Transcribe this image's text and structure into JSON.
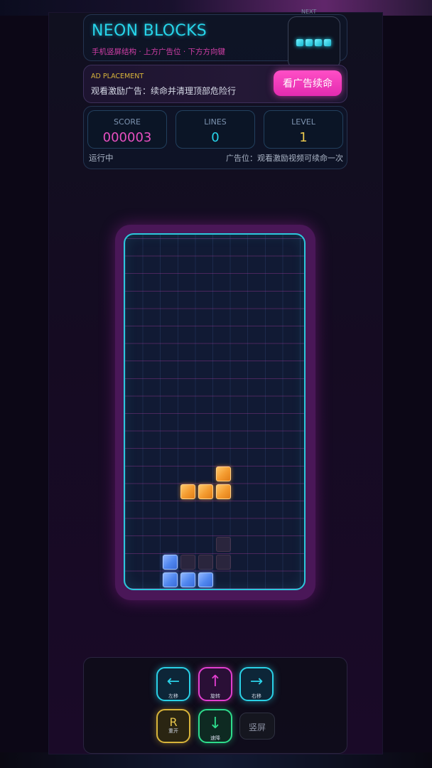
{
  "header": {
    "title": "NEON BLOCKS",
    "subtitle": "手机竖屏结构 · 上方广告位 · 下方方向键",
    "next_label": "NEXT"
  },
  "ad": {
    "label": "AD PLACEMENT",
    "text": "观看激励广告：续命并清理顶部危险行",
    "button": "看广告续命"
  },
  "stats": {
    "score_label": "SCORE",
    "score_value": "000003",
    "lines_label": "LINES",
    "lines_value": "0",
    "level_label": "LEVEL",
    "level_value": "1"
  },
  "status": {
    "state": "运行中",
    "hint": "广告位：观看激励视频可续命一次"
  },
  "board": {
    "cols": 10,
    "rows": 20,
    "cells": [
      {
        "col": 5,
        "row": 13,
        "color": "orange"
      },
      {
        "col": 3,
        "row": 14,
        "color": "orange"
      },
      {
        "col": 4,
        "row": 14,
        "color": "orange"
      },
      {
        "col": 5,
        "row": 14,
        "color": "orange"
      },
      {
        "col": 5,
        "row": 17,
        "color": "ghost"
      },
      {
        "col": 3,
        "row": 18,
        "color": "ghost"
      },
      {
        "col": 4,
        "row": 18,
        "color": "ghost"
      },
      {
        "col": 5,
        "row": 18,
        "color": "ghost"
      },
      {
        "col": 2,
        "row": 18,
        "color": "blue"
      },
      {
        "col": 2,
        "row": 19,
        "color": "blue"
      },
      {
        "col": 3,
        "row": 19,
        "color": "blue"
      },
      {
        "col": 4,
        "row": 19,
        "color": "blue"
      }
    ]
  },
  "controls": {
    "left": {
      "glyph": "←",
      "caption": "左移"
    },
    "rotate": {
      "glyph": "↑",
      "caption": "旋转"
    },
    "right": {
      "glyph": "→",
      "caption": "右移"
    },
    "restart": {
      "glyph": "R",
      "caption": "重开"
    },
    "drop": {
      "glyph": "↓",
      "caption": "速降"
    },
    "orientation": {
      "label": "竖屏"
    }
  },
  "colors": {
    "accent_cyan": "#27d4ea",
    "accent_pink": "#e23fd0",
    "accent_gold": "#d8b43a",
    "accent_green": "#2edc8c",
    "piece_orange": "#f39a2e",
    "piece_blue": "#4f86ee"
  }
}
